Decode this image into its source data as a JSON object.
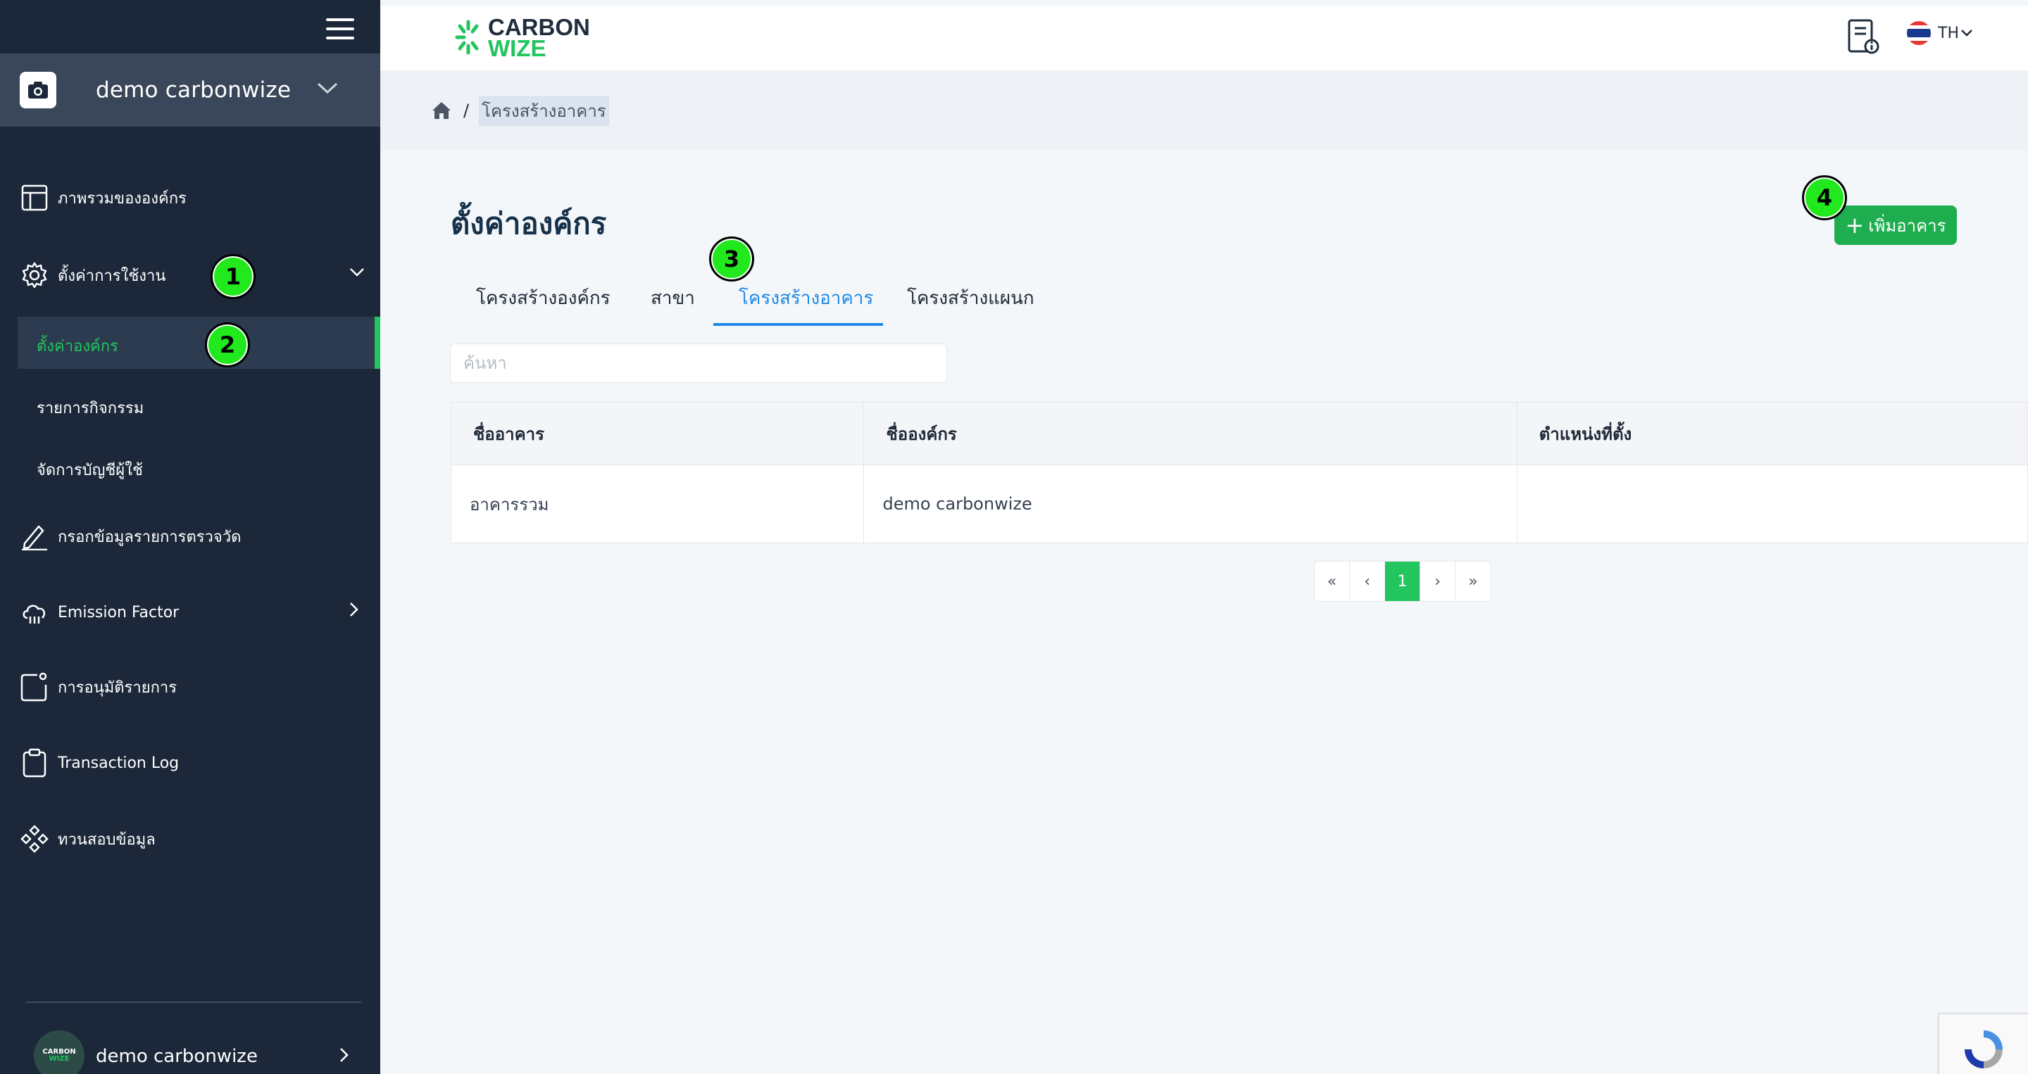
{
  "sidebar": {
    "org_name": "demo carbonwize",
    "nav": {
      "overview": "ภาพรวมขององค์กร",
      "settings": "ตั้งค่าการใช้งาน",
      "settings_sub": {
        "org_settings": "ตั้งค่าองค์กร",
        "activity_list": "รายการกิจกรรม",
        "user_accounts": "จัดการบัญชีผู้ใช้"
      },
      "data_entry": "กรอกข้อมูลรายการตรวจวัด",
      "emission_factor": "Emission Factor",
      "approval": "การอนุมัติรายการ",
      "transaction_log": "Transaction Log",
      "data_review": "ทวนสอบข้อมูล"
    },
    "user": {
      "name": "demo carbonwize",
      "avatar_text_1": "CARBON",
      "avatar_text_2": "WIZE"
    }
  },
  "header": {
    "logo_line1": "CARBON",
    "logo_line2": "WIZE",
    "language": "TH"
  },
  "breadcrumb": {
    "separator": "/",
    "current": "โครงสร้างอาคาร"
  },
  "page": {
    "title": "ตั้งค่าองค์กร",
    "add_button": "เพิ่มอาคาร",
    "add_button_plus": "+",
    "tabs": [
      "โครงสร้างองค์กร",
      "สาขา",
      "โครงสร้างอาคาร",
      "โครงสร้างแผนก"
    ],
    "active_tab": 2,
    "search_placeholder": "ค้นหา",
    "table": {
      "headers": [
        "ชื่ออาคาร",
        "ชื่อองค์กร",
        "ตำแหน่งที่ตั้ง"
      ],
      "rows": [
        [
          "อาคารรวม",
          "demo carbonwize",
          ""
        ]
      ]
    },
    "pagination": {
      "first": "«",
      "prev": "‹",
      "current": "1",
      "next": "›",
      "last": "»"
    }
  },
  "callouts": [
    "1",
    "2",
    "3",
    "4"
  ],
  "colors": {
    "sidebar_bg": "#1c283a",
    "accent_green": "#22c55e",
    "button_green": "#1fae4f",
    "tab_active_blue": "#1e88e5",
    "callout_green": "#22e81e"
  }
}
